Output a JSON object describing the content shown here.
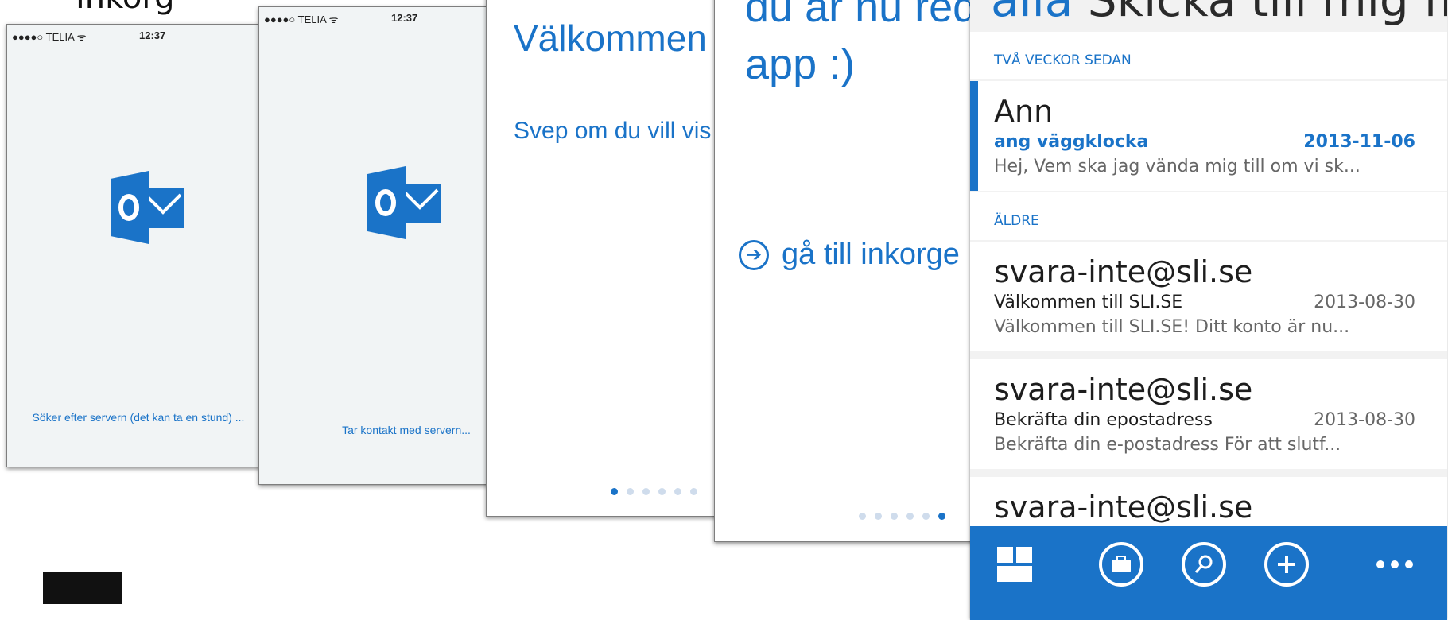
{
  "caption": "Inkorg",
  "status_bar": {
    "carrier": "●●●●○ TELIA ᯤ",
    "time": "12:37"
  },
  "screen1": {
    "loading_text": "Söker efter servern (det kan ta en stund) ..."
  },
  "screen2": {
    "loading_text": "Tar kontakt med servern..."
  },
  "screen3": {
    "title": "Välkommen",
    "subtitle": "Svep om du vill vis hjälpsamma tips..",
    "dots_total": 6,
    "dots_active": 0
  },
  "screen4": {
    "message": "du är nu red använda dir app :)",
    "goto_label": "gå till inkorge",
    "dots_total": 6,
    "dots_active": 5
  },
  "screen5": {
    "header_accent": "alla",
    "header_rest": " Skicka till mig  flagga",
    "sections": [
      {
        "label": "TVÅ VECKOR SEDAN"
      },
      {
        "label": "ÄLDRE"
      }
    ],
    "mails": [
      {
        "sender": "Ann",
        "subject": "ang väggklocka",
        "date": "2013-11-06",
        "preview": "Hej, Vem ska jag vända mig till om vi sk..."
      },
      {
        "sender": "svara-inte@sli.se",
        "subject": "Välkommen till SLI.SE",
        "date": "2013-08-30",
        "preview": "Välkommen till SLI.SE!  Ditt konto är nu..."
      },
      {
        "sender": "svara-inte@sli.se",
        "subject": "Bekräfta din epostadress",
        "date": "2013-08-30",
        "preview": "Bekräfta din e-postadress  För att slutf..."
      },
      {
        "sender": "svara-inte@sli.se",
        "subject": "",
        "date": "",
        "preview": ""
      }
    ],
    "appbar_icons": [
      "grid-icon",
      "briefcase-icon",
      "search-icon",
      "plus-icon",
      "more-icon"
    ]
  },
  "colors": {
    "accent": "#1a73c8",
    "phone_bg": "#f1f4f5",
    "list_bg": "#f2f2f2"
  }
}
